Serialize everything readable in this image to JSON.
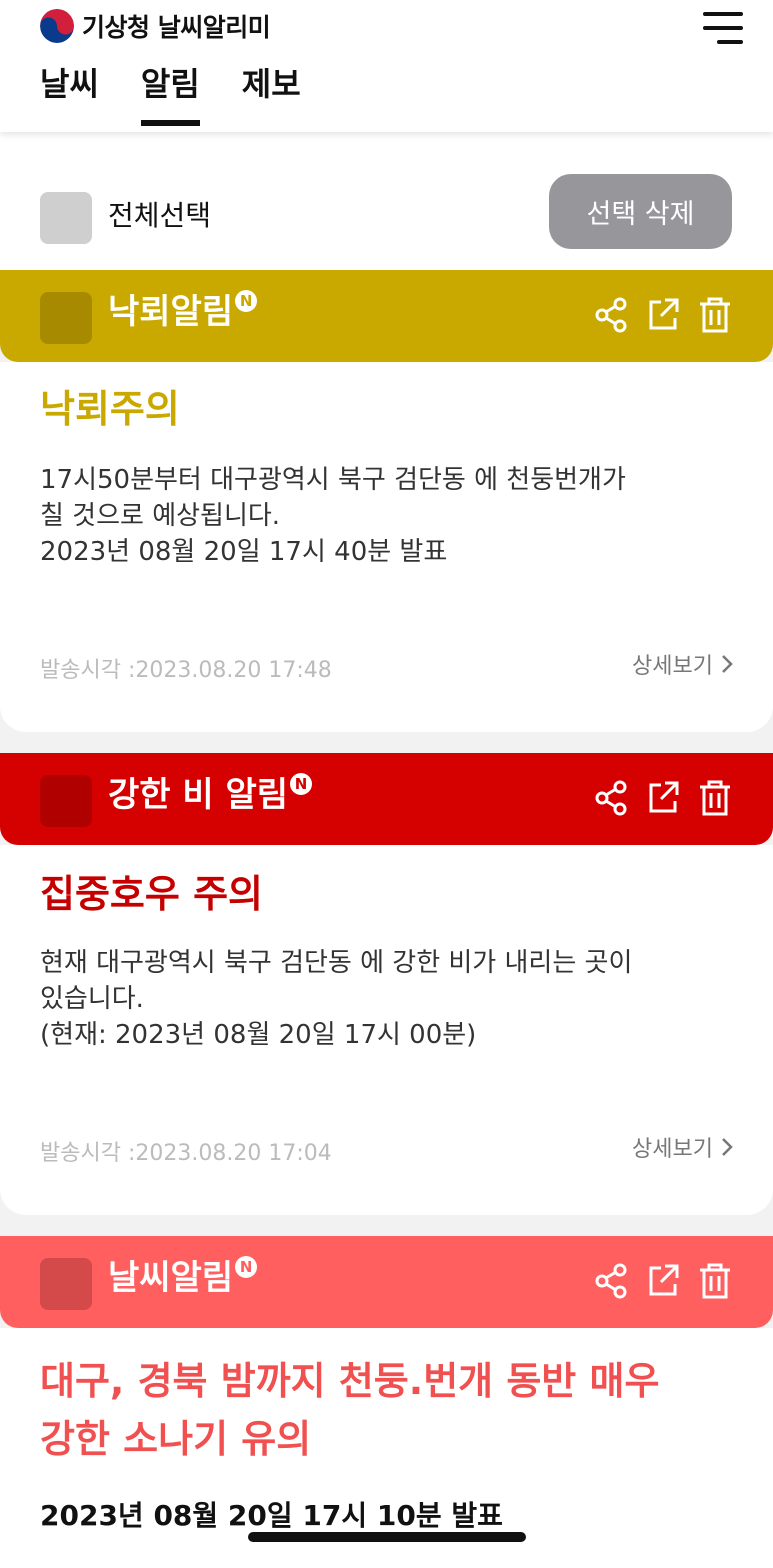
{
  "app": {
    "logo_text": "기상청 날씨알리미"
  },
  "tabs": [
    {
      "label": "날씨",
      "active": false
    },
    {
      "label": "알림",
      "active": true
    },
    {
      "label": "제보",
      "active": false
    }
  ],
  "toolbar": {
    "select_all_label": "전체선택",
    "delete_label": "선택 삭제"
  },
  "alerts": [
    {
      "category": "낙뢰알림",
      "badge": "N",
      "color": "#c9a800",
      "checkbox_color": "#a88a00",
      "heading": "낙뢰주의",
      "heading_color": "#c9a800",
      "body": "17시50분부터 대구광역시 북구 검단동 에 천둥번개가\n칠 것으로 예상됩니다.\n2023년 08월 20일 17시 40분 발표",
      "sent_at": "발송시각 :2023.08.20 17:48",
      "detail_label": "상세보기"
    },
    {
      "category": "강한 비 알림",
      "badge": "N",
      "color": "#d50000",
      "checkbox_color": "#b00000",
      "heading": "집중호우 주의",
      "heading_color": "#c40000",
      "body": "현재 대구광역시 북구 검단동 에 강한 비가 내리는 곳이\n있습니다.\n(현재: 2023년 08월 20일 17시 00분)",
      "sent_at": "발송시각 :2023.08.20 17:04",
      "detail_label": "상세보기"
    },
    {
      "category": "날씨알림",
      "badge": "N",
      "color": "#ff5f5f",
      "checkbox_color": "#d44a4a",
      "heading": "대구, 경북 밤까지 천둥.번개 동반 매우\n강한 소나기 유의",
      "heading_color": "#f05050",
      "date_line": "2023년 08월 20일 17시 10분 발표"
    }
  ],
  "icons": {
    "share": "share-icon",
    "open": "external-link-icon",
    "delete": "trash-icon",
    "menu": "hamburger-menu-icon"
  }
}
